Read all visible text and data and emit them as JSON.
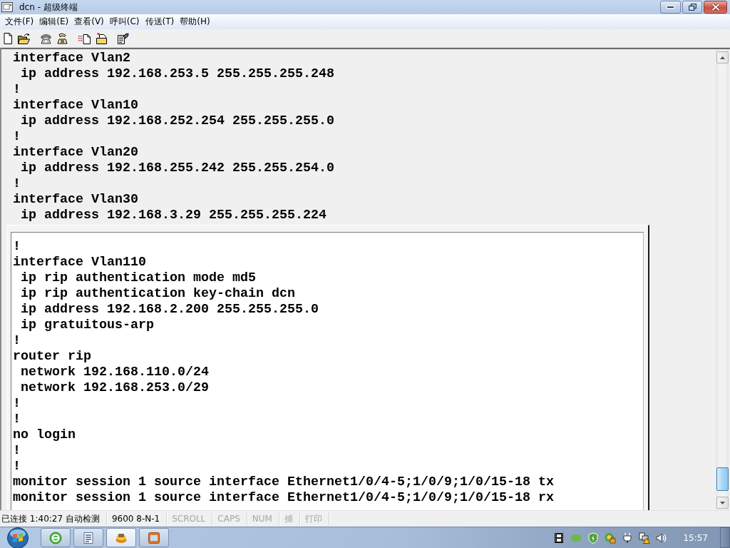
{
  "window": {
    "title": "dcn - 超级终端"
  },
  "menu_bar": [
    "文件(F)",
    "编辑(E)",
    "查看(V)",
    "呼叫(C)",
    "传送(T)",
    "帮助(H)"
  ],
  "toolbar": [
    [
      {
        "kind": "new",
        "disabled": false
      },
      {
        "kind": "open",
        "disabled": false
      }
    ],
    [
      {
        "kind": "call",
        "disabled": true
      },
      {
        "kind": "disconnect",
        "disabled": false
      }
    ],
    [
      {
        "kind": "send",
        "disabled": false
      },
      {
        "kind": "receive",
        "disabled": false
      }
    ],
    [
      {
        "kind": "properties",
        "disabled": false
      }
    ]
  ],
  "terminal": {
    "lines": [
      "interface Vlan2",
      " ip address 192.168.253.5 255.255.255.248",
      "!",
      "interface Vlan10",
      " ip address 192.168.252.254 255.255.255.0",
      "!",
      "interface Vlan20",
      " ip address 192.168.255.242 255.255.254.0",
      "!",
      "interface Vlan30",
      " ip address 192.168.3.29 255.255.255.224"
    ],
    "inset_panel": {
      "lines": [
        "!",
        "interface Vlan110",
        " ip rip authentication mode md5",
        " ip rip authentication key-chain dcn",
        " ip address 192.168.2.200 255.255.255.0",
        " ip gratuitous-arp",
        "!",
        "router rip",
        " network 192.168.110.0/24",
        " network 192.168.253.0/29",
        "!",
        "!",
        "no login",
        "!",
        "!",
        "monitor session 1 source interface Ethernet1/0/4-5;1/0/9;1/0/15-18 tx",
        "monitor session 1 source interface Ethernet1/0/4-5;1/0/9;1/0/15-18 rx"
      ]
    }
  },
  "status_bar": [
    {
      "text": "已连接 1:40:27 自动检测",
      "disabled": false
    },
    {
      "text": "9600 8-N-1",
      "disabled": false
    },
    {
      "text": "SCROLL",
      "disabled": true
    },
    {
      "text": "CAPS",
      "disabled": true
    },
    {
      "text": "NUM",
      "disabled": true
    },
    {
      "text": "捕",
      "disabled": true
    },
    {
      "text": "打印",
      "disabled": true
    }
  ],
  "taskbar": {
    "apps": [
      {
        "kind": "browser",
        "selected": false
      },
      {
        "kind": "word",
        "selected": false
      },
      {
        "kind": "terminal",
        "selected": true
      },
      {
        "kind": "viewer",
        "selected": false
      }
    ],
    "clock": "15:57"
  }
}
